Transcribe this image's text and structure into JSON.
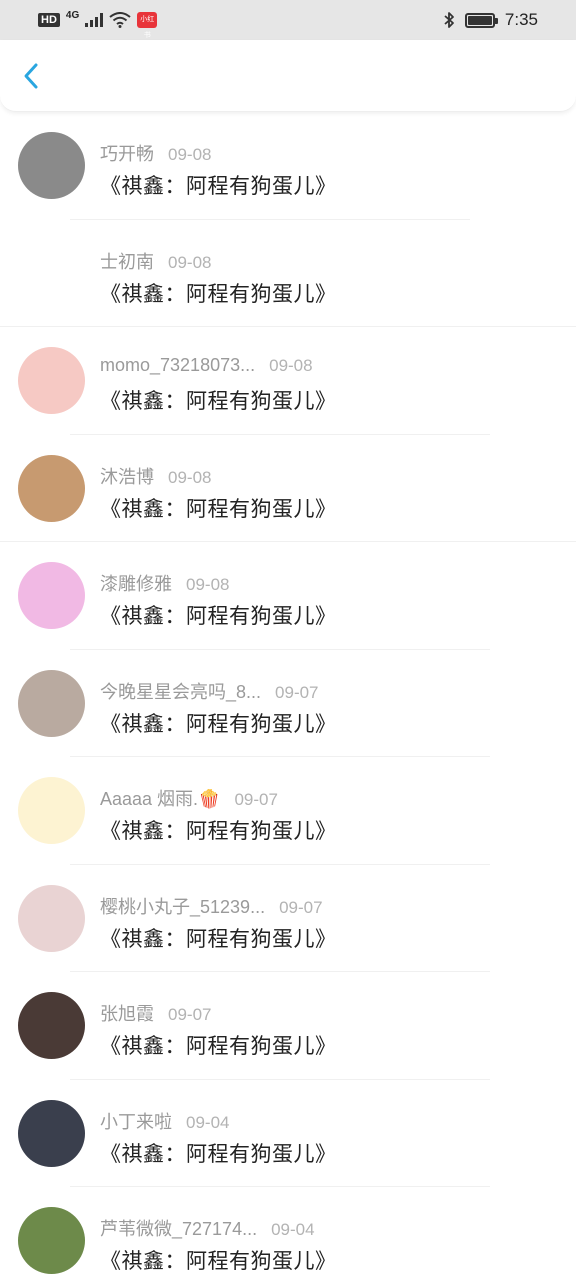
{
  "status_bar": {
    "hd": "HD",
    "network": "4G",
    "app_badge": "小红书",
    "time": "7:35"
  },
  "header": {
    "back_icon": "chevron-left-icon",
    "accent": "#2aa6e0"
  },
  "items": [
    {
      "name": "巧开畅",
      "date": "09-08",
      "title": "《祺鑫：阿程有狗蛋儿》",
      "avatar": "#8a8a8a"
    },
    {
      "name": "士初南",
      "date": "09-08",
      "title": "《祺鑫：阿程有狗蛋儿》",
      "avatar": ""
    },
    {
      "name": "momo_73218073...",
      "date": "09-08",
      "title": "《祺鑫：阿程有狗蛋儿》",
      "avatar": "#f6c9c4"
    },
    {
      "name": "沐浩博",
      "date": "09-08",
      "title": "《祺鑫：阿程有狗蛋儿》",
      "avatar": "#c79a70"
    },
    {
      "name": "漆雕修雅",
      "date": "09-08",
      "title": "《祺鑫：阿程有狗蛋儿》",
      "avatar": "#f1b9e4"
    },
    {
      "name": "今晚星星会亮吗_8...",
      "date": "09-07",
      "title": "《祺鑫：阿程有狗蛋儿》",
      "avatar": "#b9aaa0"
    },
    {
      "name": "Aaaaa 烟雨.🍿",
      "date": "09-07",
      "title": "《祺鑫：阿程有狗蛋儿》",
      "avatar": "#fdf3d2"
    },
    {
      "name": "樱桃小丸子_51239...",
      "date": "09-07",
      "title": "《祺鑫：阿程有狗蛋儿》",
      "avatar": "#e9d3d3"
    },
    {
      "name": "张旭霞",
      "date": "09-07",
      "title": "《祺鑫：阿程有狗蛋儿》",
      "avatar": "#4a3a36"
    },
    {
      "name": "小丁来啦",
      "date": "09-04",
      "title": "《祺鑫：阿程有狗蛋儿》",
      "avatar": "#3a3f4d"
    },
    {
      "name": "芦苇微微_727174...",
      "date": "09-04",
      "title": "《祺鑫：阿程有狗蛋儿》",
      "avatar": "#6d8a4a"
    }
  ]
}
